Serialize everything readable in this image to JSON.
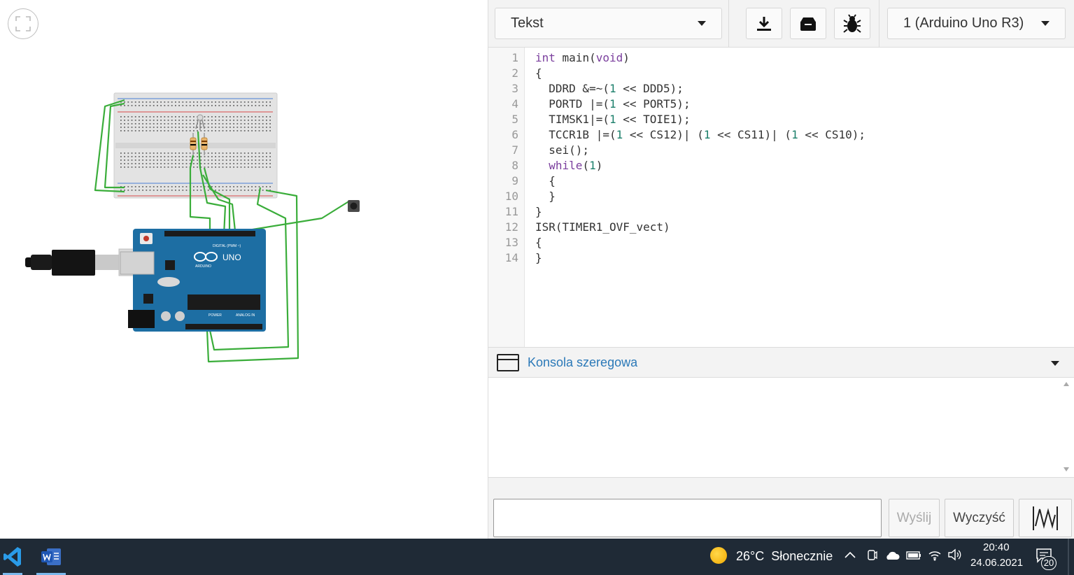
{
  "toolbar": {
    "mode": "Tekst",
    "device": "1 (Arduino Uno R3)",
    "icons": [
      "download-icon",
      "library-icon",
      "debug-bug-icon"
    ]
  },
  "editor": {
    "line_numbers": [
      "1",
      "2",
      "3",
      "4",
      "5",
      "6",
      "7",
      "8",
      "9",
      "10",
      "11",
      "12",
      "13",
      "14"
    ],
    "lines": [
      "int main(void)",
      "{",
      "  DDRD &=~(1 << DDD5);",
      "  PORTD |=(1 << PORT5);",
      "  TIMSK1|=(1 << TOIE1);",
      "  TCCR1B |=(1 << CS12)| (1 << CS11)| (1 << CS10);",
      "  sei();",
      "  while(1)",
      "  {",
      "  }",
      "}",
      "ISR(TIMER1_OVF_vect)",
      "{",
      "}"
    ]
  },
  "console": {
    "title": "Konsola szeregowa",
    "send_label": "Wyślij",
    "clear_label": "Wyczyść",
    "input_value": ""
  },
  "circuit": {
    "board_labels": {
      "brand": "ARDUINO",
      "model": "UNO",
      "digital": "DIGITAL (PWM ~)",
      "power": "POWER",
      "analog": "ANALOG IN"
    }
  },
  "taskbar": {
    "apps": [
      "vscode-icon",
      "word-icon"
    ],
    "weather": "26°C  Słonecznie",
    "time": "20:40",
    "date": "24.06.2021",
    "notifications": "20"
  },
  "colors": {
    "wire": "#3aad3a",
    "board": "#1d6ea3",
    "accent_link": "#2b79b8",
    "taskbar": "#1f2a36"
  }
}
